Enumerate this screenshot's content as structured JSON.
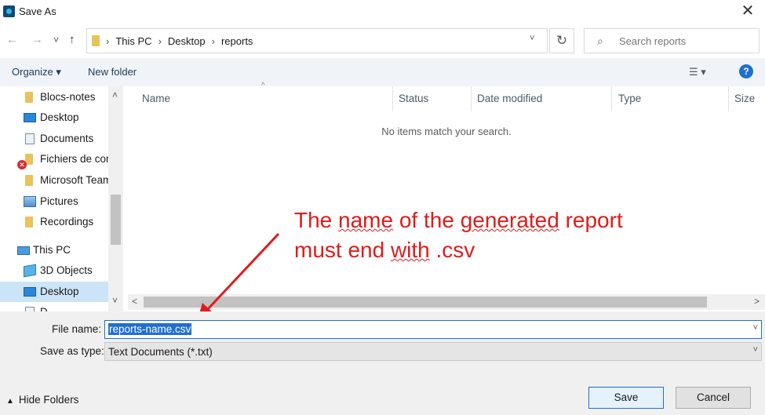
{
  "window": {
    "title": "Save As",
    "close_glyph": "✕"
  },
  "nav": {
    "back": "←",
    "forward": "→",
    "recent": "˅",
    "up": "↑",
    "breadcrumbs": [
      "This PC",
      "Desktop",
      "reports"
    ],
    "sep": "›",
    "dropdown": "˅",
    "refresh": "↻",
    "search_placeholder": "Search reports",
    "search_glyph": "⌕"
  },
  "toolbar": {
    "organize": "Organize ▾",
    "new_folder": "New folder",
    "view_glyph": "☰ ▾",
    "help": "?"
  },
  "sidebar": {
    "items": [
      {
        "label": "Blocs-notes",
        "icon": "folder-icon"
      },
      {
        "label": "Desktop",
        "icon": "desktop-icon"
      },
      {
        "label": "Documents",
        "icon": "document-icon"
      },
      {
        "label": "Fichiers de conv",
        "icon": "folder-icon",
        "error_badge": "✕"
      },
      {
        "label": "Microsoft Teams",
        "icon": "folder-icon"
      },
      {
        "label": "Pictures",
        "icon": "pictures-icon"
      },
      {
        "label": "Recordings",
        "icon": "folder-icon"
      },
      {
        "label": "This PC",
        "icon": "computer-icon"
      },
      {
        "label": "3D Objects",
        "icon": "cube-icon"
      },
      {
        "label": "Desktop",
        "icon": "desktop-icon",
        "selected": true
      },
      {
        "label": "D",
        "icon": "document-icon"
      }
    ]
  },
  "columns": [
    "Name",
    "Status",
    "Date modified",
    "Type",
    "Size"
  ],
  "sort_glyph": "^",
  "empty_message": "No items match your search.",
  "scroll": {
    "up": "˄",
    "down": "˅",
    "left": "<",
    "right": ">"
  },
  "annotation": {
    "line1_parts": [
      "The ",
      "name",
      " of the ",
      "generated",
      " report"
    ],
    "line2_parts": [
      "must end ",
      "with",
      " .csv"
    ],
    "color": "#e11b1b"
  },
  "form": {
    "file_name_label": "File name:",
    "file_name_value": "reports-name.csv",
    "save_type_label": "Save as type:",
    "save_type_value": "Text Documents (*.txt)",
    "chevron": "˅"
  },
  "footer": {
    "hide_folders": "Hide Folders",
    "hide_glyph": "▲",
    "save": "Save",
    "cancel": "Cancel"
  },
  "colors": {
    "accent": "#1f6fd1",
    "selection": "#cce4f7",
    "toolbar_bg": "#f0f4f9"
  }
}
